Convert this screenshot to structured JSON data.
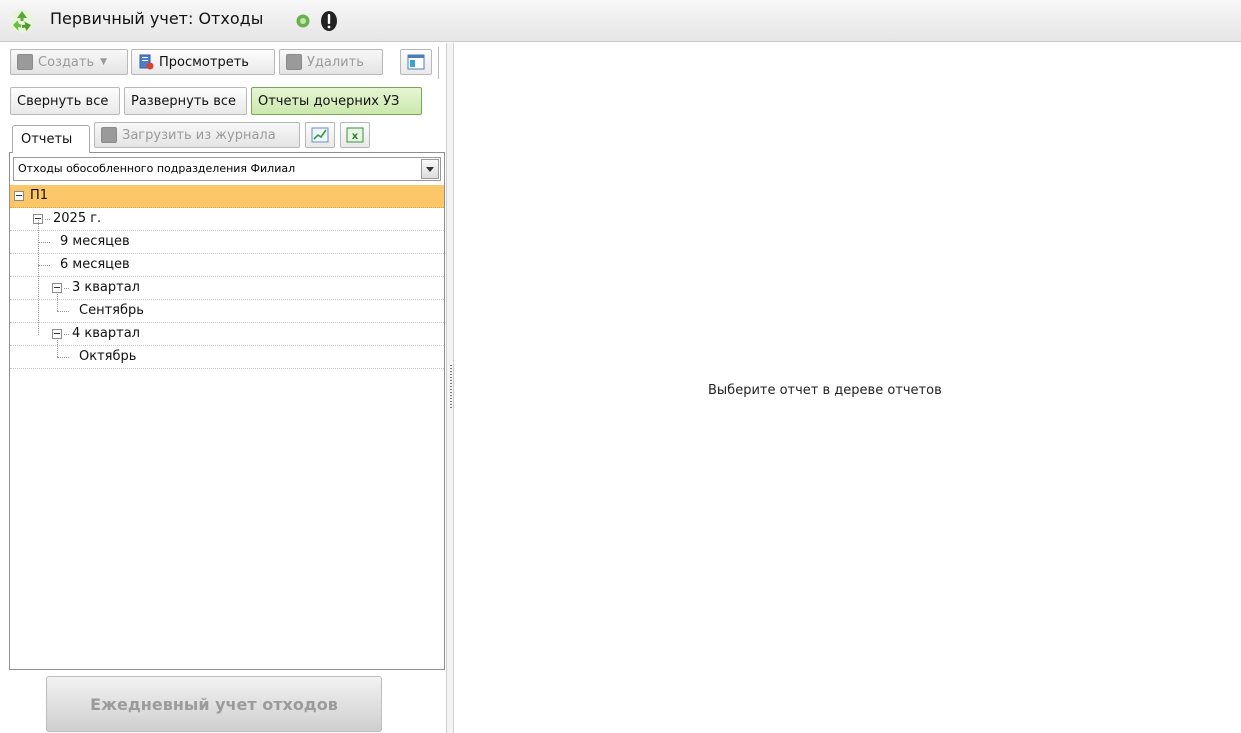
{
  "title": "Первичный учет: Отходы",
  "icons": {
    "app": "recycle-icon",
    "help": "help-icon",
    "warning": "exclamation-icon"
  },
  "toolbar": {
    "create_label": "Создать",
    "view_label": "Просмотреть",
    "delete_label": "Удалить"
  },
  "filters": {
    "collapse_all": "Свернуть все",
    "expand_all": "Развернуть все",
    "child_reports": "Отчеты дочерних УЗ"
  },
  "tabs": {
    "reports": "Отчеты",
    "load_from_journal": "Загрузить из журнала"
  },
  "combo": {
    "selected": "Отходы обособленного подразделения Филиал"
  },
  "tree": {
    "root": "П1",
    "year": "2025 г.",
    "nine_months": "9 месяцев",
    "six_months": "6 месяцев",
    "q3": "3 квартал",
    "september": "Сентябрь",
    "q4": "4 квартал",
    "october": "Октябрь"
  },
  "daily_button": "Ежедневный учет отходов",
  "main": {
    "empty_message": "Выберите отчет в дереве отчетов"
  },
  "colors": {
    "selection": "#fcc768",
    "green_button": "#cbe8ad",
    "recycle": "#5aa832"
  }
}
